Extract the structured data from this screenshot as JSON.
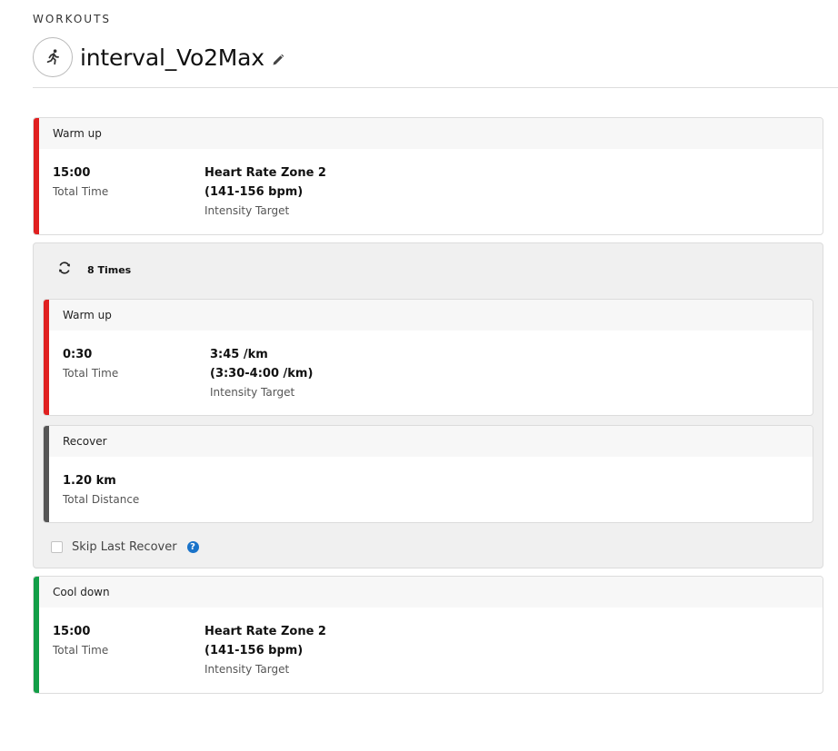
{
  "breadcrumb": "WORKOUTS",
  "workout": {
    "title": "interval_Vo2Max",
    "icon": "running-person-icon"
  },
  "steps": [
    {
      "label": "Warm up",
      "color": "#e02020",
      "primary": {
        "value": "15:00",
        "label": "Total Time"
      },
      "target": {
        "line1": "Heart Rate Zone 2",
        "line2": "(141-156 bpm)",
        "label": "Intensity Target"
      }
    },
    {
      "label": "Cool down",
      "color": "#129e47",
      "primary": {
        "value": "15:00",
        "label": "Total Time"
      },
      "target": {
        "line1": "Heart Rate Zone 2",
        "line2": "(141-156 bpm)",
        "label": "Intensity Target"
      }
    }
  ],
  "repeat": {
    "label": "8 Times",
    "icon": "repeat-icon",
    "steps": [
      {
        "label": "Warm up",
        "color": "#e02020",
        "primary": {
          "value": "0:30",
          "label": "Total Time"
        },
        "target": {
          "line1": "3:45 /km",
          "line2": "(3:30-4:00 /km)",
          "label": "Intensity Target"
        }
      },
      {
        "label": "Recover",
        "color": "#555555",
        "primary": {
          "value": "1.20 km",
          "label": "Total Distance"
        }
      }
    ],
    "skip_last_recover": {
      "label": "Skip Last Recover",
      "checked": false,
      "help_icon": "help-icon"
    }
  }
}
